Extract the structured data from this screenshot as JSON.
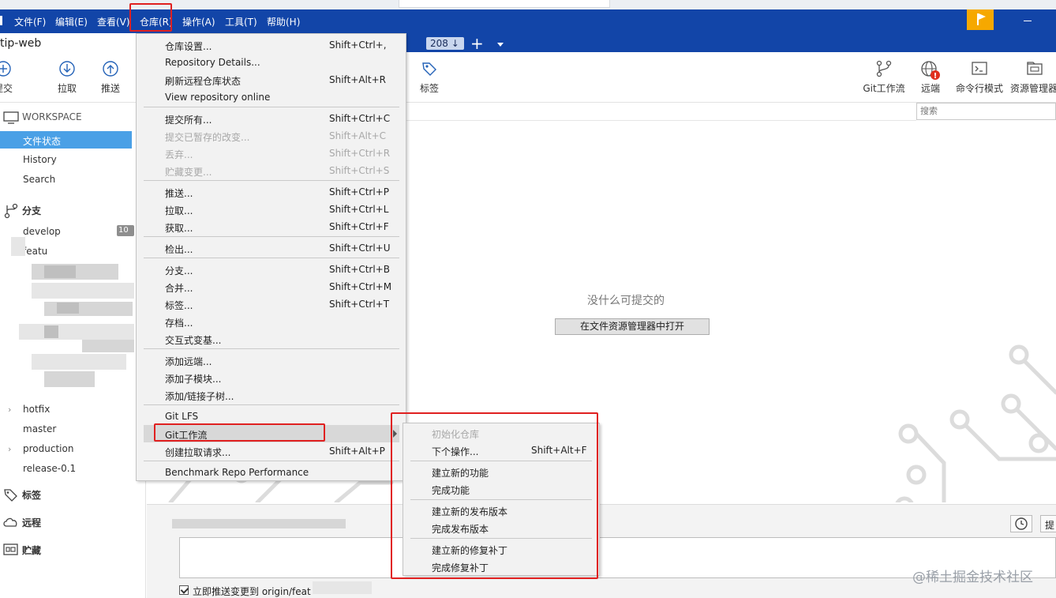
{
  "menubar": {
    "items": [
      "文件(F)",
      "编辑(E)",
      "查看(V)",
      "仓库(R)",
      "操作(A)",
      "工具(T)",
      "帮助(H)"
    ]
  },
  "tab": {
    "repo_name": "tip-web",
    "count": "208 ↓",
    "plus": "+"
  },
  "toolbar": {
    "commit": "提交",
    "pull": "拉取",
    "push": "推送",
    "tag": "标签",
    "gitflow": "Git工作流",
    "remote": "远端",
    "terminal": "命令行模式",
    "explorer": "资源管理器",
    "search_placeholder": "搜索"
  },
  "sidebar": {
    "workspace": "WORKSPACE",
    "workspace_items": [
      "文件状态",
      "History",
      "Search"
    ],
    "branches": "分支",
    "branch_items": [
      "develop",
      "featu",
      "hotfix",
      "master",
      "production",
      "release-0.1"
    ],
    "develop_badge": "10",
    "tags": "标签",
    "remotes": "远程",
    "stashes": "贮藏"
  },
  "main": {
    "empty_message": "没什么可提交的",
    "open_button": "在文件资源管理器中打开",
    "push_checkbox": "立即推送变更到 origin/feat",
    "commit_button": "提"
  },
  "repo_menu": {
    "items": [
      {
        "label": "仓库设置...",
        "shortcut": "Shift+Ctrl+,"
      },
      {
        "label": "Repository Details...",
        "shortcut": ""
      },
      {
        "label": "刷新远程仓库状态",
        "shortcut": "Shift+Alt+R"
      },
      {
        "label": "View repository online",
        "shortcut": ""
      },
      {
        "label": "提交所有...",
        "shortcut": "Shift+Ctrl+C"
      },
      {
        "label": "提交已暂存的改变...",
        "shortcut": "Shift+Alt+C"
      },
      {
        "label": "丢弃...",
        "shortcut": "Shift+Ctrl+R"
      },
      {
        "label": "贮藏变更...",
        "shortcut": "Shift+Ctrl+S"
      },
      {
        "label": "推送...",
        "shortcut": "Shift+Ctrl+P"
      },
      {
        "label": "拉取...",
        "shortcut": "Shift+Ctrl+L"
      },
      {
        "label": "获取...",
        "shortcut": "Shift+Ctrl+F"
      },
      {
        "label": "检出...",
        "shortcut": "Shift+Ctrl+U"
      },
      {
        "label": "分支...",
        "shortcut": "Shift+Ctrl+B"
      },
      {
        "label": "合并...",
        "shortcut": "Shift+Ctrl+M"
      },
      {
        "label": "标签...",
        "shortcut": "Shift+Ctrl+T"
      },
      {
        "label": "存档...",
        "shortcut": ""
      },
      {
        "label": "交互式变基...",
        "shortcut": ""
      },
      {
        "label": "添加远端...",
        "shortcut": ""
      },
      {
        "label": "添加子模块...",
        "shortcut": ""
      },
      {
        "label": "添加/链接子树...",
        "shortcut": ""
      },
      {
        "label": "Git LFS",
        "shortcut": ""
      },
      {
        "label": "Git工作流",
        "shortcut": ""
      },
      {
        "label": "创建拉取请求...",
        "shortcut": "Shift+Alt+P"
      },
      {
        "label": "Benchmark Repo Performance",
        "shortcut": ""
      }
    ]
  },
  "gitflow_menu": {
    "items": [
      {
        "label": "初始化仓库",
        "shortcut": ""
      },
      {
        "label": "下个操作...",
        "shortcut": "Shift+Alt+F"
      },
      {
        "label": "建立新的功能",
        "shortcut": ""
      },
      {
        "label": "完成功能",
        "shortcut": ""
      },
      {
        "label": "建立新的发布版本",
        "shortcut": ""
      },
      {
        "label": "完成发布版本",
        "shortcut": ""
      },
      {
        "label": "建立新的修复补丁",
        "shortcut": ""
      },
      {
        "label": "完成修复补丁",
        "shortcut": ""
      }
    ]
  },
  "watermark": "@稀土掘金技术社区",
  "colors": {
    "menubar": "#1245a8",
    "selection": "#4aa0e6",
    "annotation": "#e02020",
    "flag": "#f6a800",
    "remote_alert": "#e0301e"
  }
}
